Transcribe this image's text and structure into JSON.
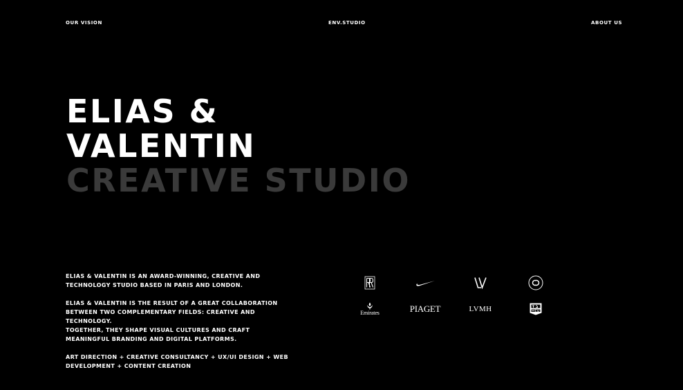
{
  "nav": {
    "left": "OUR VISION",
    "center": "ENV.STUDIO",
    "right": "ABOUT US"
  },
  "hero": {
    "line1": "ELIAS &",
    "line2": "VALENTIN",
    "line3": "CREATIVE STUDIO"
  },
  "about": {
    "p1": "ELIAS & VALENTIN IS AN AWARD-WINNING, CREATIVE AND TECHNOLOGY STUDIO BASED IN PARIS AND LONDON.",
    "p2a": "ELIAS & VALENTIN IS THE RESULT OF A GREAT COLLABORATION BETWEEN TWO COMPLEMENTARY FIELDS: CREATIVE AND TECHNOLOGY.",
    "p2b": "TOGETHER, THEY SHAPE VISUAL CULTURES AND CRAFT MEANINGFUL BRANDING AND DIGITAL PLATFORMS.",
    "p3": "ART DIRECTION + CREATIVE CONSULTANCY + UX/UI DESIGN + WEB DEVELOPMENT + CONTENT CREATION"
  },
  "clients": {
    "emirates": "Emirates",
    "piaget": "PIAGET",
    "lvmh": "LVMH"
  },
  "colors": {
    "background": "#000000",
    "text": "#ffffff",
    "muted": "#3a3a3a"
  },
  "icons": {
    "rolls_royce": "rolls-royce-logo",
    "nike": "nike-swoosh-logo",
    "louis_vuitton": "louis-vuitton-logo",
    "chanel": "chanel-logo",
    "emirates": "emirates-logo",
    "piaget": "piaget-logo",
    "lvmh": "lvmh-logo",
    "tag_heuer": "tag-heuer-logo"
  }
}
